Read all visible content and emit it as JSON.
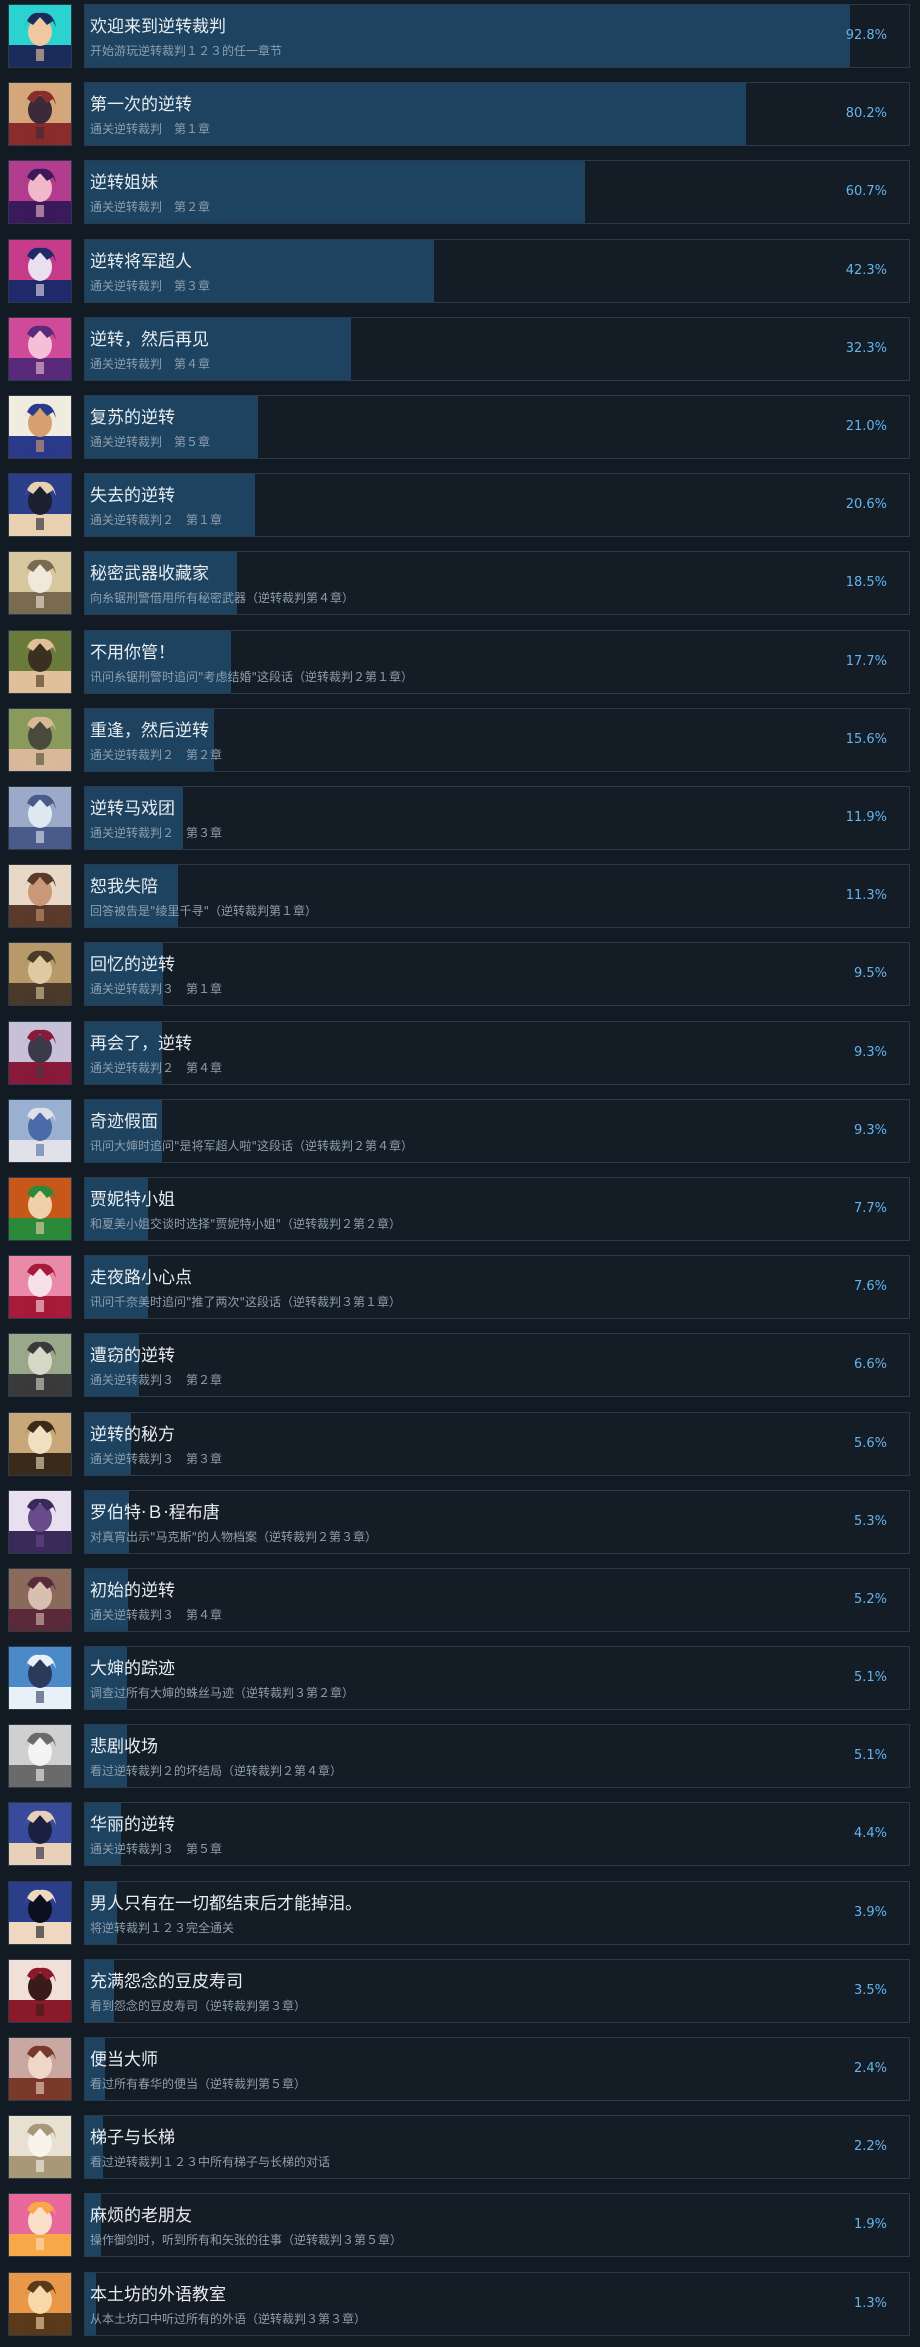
{
  "achievements": [
    {
      "title": "欢迎来到逆转裁判",
      "description": "开始游玩逆转裁判１２３的任一章节",
      "percent": 92.8,
      "percent_label": "92.8%",
      "portrait": "phoenix-wright-portrait",
      "colors": [
        "#2ad3cf",
        "#1c2c5a",
        "#f0c8a0"
      ]
    },
    {
      "title": "第一次的逆转",
      "description": "通关逆转裁判　第１章",
      "percent": 80.2,
      "percent_label": "80.2%",
      "portrait": "episode-1-portrait",
      "colors": [
        "#d4a77a",
        "#8a2c2c",
        "#3a2a3a"
      ]
    },
    {
      "title": "逆转姐妹",
      "description": "通关逆转裁判　第２章",
      "percent": 60.7,
      "percent_label": "60.7%",
      "portrait": "episode-2-portrait",
      "colors": [
        "#b23c8e",
        "#3a1a5a",
        "#f0b8c8"
      ]
    },
    {
      "title": "逆转将军超人",
      "description": "通关逆转裁判　第３章",
      "percent": 42.3,
      "percent_label": "42.3%",
      "portrait": "episode-3-portrait",
      "colors": [
        "#c63c8a",
        "#1e2a6a",
        "#e8e0f0"
      ]
    },
    {
      "title": "逆转，然后再见",
      "description": "通关逆转裁判　第４章",
      "percent": 32.3,
      "percent_label": "32.3%",
      "portrait": "episode-4-portrait",
      "colors": [
        "#d04a9a",
        "#5a2a7a",
        "#f4c0d8"
      ]
    },
    {
      "title": "复苏的逆转",
      "description": "通关逆转裁判　第５章",
      "percent": 21.0,
      "percent_label": "21.0%",
      "portrait": "episode-5-portrait",
      "colors": [
        "#f0ece0",
        "#2c3a8a",
        "#d8a070"
      ]
    },
    {
      "title": "失去的逆转",
      "description": "通关逆转裁判２　第１章",
      "percent": 20.6,
      "percent_label": "20.6%",
      "portrait": "lost-turnabout-portrait",
      "colors": [
        "#2a3e8a",
        "#e8d0b0",
        "#1a2030"
      ]
    },
    {
      "title": "秘密武器收藏家",
      "description": "向糸锯刑警借用所有秘密武器（逆转裁判第４章）",
      "percent": 18.5,
      "percent_label": "18.5%",
      "portrait": "gumshoe-portrait",
      "colors": [
        "#d8c8a0",
        "#7a6a50",
        "#f0e8d8"
      ]
    },
    {
      "title": "不用你管！",
      "description": "讯问糸锯刑警时追问\"考虑结婚\"这段话（逆转裁判２第１章）",
      "percent": 17.7,
      "percent_label": "17.7%",
      "portrait": "gumshoe-coat-portrait",
      "colors": [
        "#6a7a3a",
        "#e0c098",
        "#3a3020"
      ]
    },
    {
      "title": "重逢，然后逆转",
      "description": "通关逆转裁判２　第２章",
      "percent": 15.6,
      "percent_label": "15.6%",
      "portrait": "reunion-portrait",
      "colors": [
        "#8a9a5a",
        "#d8b898",
        "#4a4a3a"
      ]
    },
    {
      "title": "逆转马戏团",
      "description": "通关逆转裁判２　第３章",
      "percent": 11.9,
      "percent_label": "11.9%",
      "portrait": "circus-portrait",
      "colors": [
        "#9aaac8",
        "#4a5a8a",
        "#e0e8f0"
      ]
    },
    {
      "title": "恕我失陪",
      "description": "回答被告是\"绫里千寻\"（逆转裁判第１章）",
      "percent": 11.3,
      "percent_label": "11.3%",
      "portrait": "mia-fey-portrait",
      "colors": [
        "#e8d8c8",
        "#5a3a2a",
        "#c89878"
      ]
    },
    {
      "title": "回忆的逆转",
      "description": "通关逆转裁判３　第１章",
      "percent": 9.5,
      "percent_label": "9.5%",
      "portrait": "memories-portrait",
      "colors": [
        "#b89a6a",
        "#4a3a2a",
        "#e0c8a0"
      ]
    },
    {
      "title": "再会了，逆转",
      "description": "通关逆转裁判２　第４章",
      "percent": 9.3,
      "percent_label": "9.3%",
      "portrait": "farewell-portrait",
      "colors": [
        "#c8c0d8",
        "#8a1a3a",
        "#3a3a4a"
      ]
    },
    {
      "title": "奇迹假面",
      "description": "讯问大婶时追问\"是将军超人啦\"这段话（逆转裁判２第４章）",
      "percent": 9.3,
      "percent_label": "9.3%",
      "portrait": "wendy-oldbag-portrait",
      "colors": [
        "#9ab0d0",
        "#e0e0e8",
        "#4a6aa8"
      ]
    },
    {
      "title": "贾妮特小姐",
      "description": "和夏美小姐交谈时选择\"贾妮特小姐\"（逆转裁判２第２章）",
      "percent": 7.7,
      "percent_label": "7.7%",
      "portrait": "lotta-hart-portrait",
      "colors": [
        "#c8581a",
        "#2a8a3a",
        "#f0d0a8"
      ]
    },
    {
      "title": "走夜路小心点",
      "description": "讯问千奈美时追问\"推了两次\"这段话（逆转裁判３第１章）",
      "percent": 7.6,
      "percent_label": "7.6%",
      "portrait": "dahlia-portrait",
      "colors": [
        "#e88aa8",
        "#a81a3a",
        "#f8e0e8"
      ]
    },
    {
      "title": "遭窃的逆转",
      "description": "通关逆转裁判３　第２章",
      "percent": 6.6,
      "percent_label": "6.6%",
      "portrait": "stolen-turnabout-portrait",
      "colors": [
        "#9aa88a",
        "#3a3a3a",
        "#d8d8c8"
      ]
    },
    {
      "title": "逆转的秘方",
      "description": "通关逆转裁判３　第３章",
      "percent": 5.6,
      "percent_label": "5.6%",
      "portrait": "recipe-portrait",
      "colors": [
        "#c8a878",
        "#3a2a1a",
        "#f0e0c0"
      ]
    },
    {
      "title": "罗伯特·Ｂ·程布唐",
      "description": "对真宵出示\"马克斯\"的人物档案（逆转裁判２第３章）",
      "percent": 5.3,
      "percent_label": "5.3%",
      "portrait": "maya-fey-portrait",
      "colors": [
        "#e8e0f0",
        "#3a2a5a",
        "#6a4a8a"
      ]
    },
    {
      "title": "初始的逆转",
      "description": "通关逆转裁判３　第４章",
      "percent": 5.2,
      "percent_label": "5.2%",
      "portrait": "beginnings-portrait",
      "colors": [
        "#8a6a5a",
        "#5a2a3a",
        "#d8c0b0"
      ]
    },
    {
      "title": "大婶的踪迹",
      "description": "调查过所有大婶的蛛丝马迹（逆转裁判３第２章）",
      "percent": 5.1,
      "percent_label": "5.1%",
      "portrait": "camera-portrait",
      "colors": [
        "#4a8ac8",
        "#e8f0f8",
        "#2a3a5a"
      ]
    },
    {
      "title": "悲剧收场",
      "description": "看过逆转裁判２的坏结局（逆转裁判２第４章）",
      "percent": 5.1,
      "percent_label": "5.1%",
      "portrait": "tragedy-portrait",
      "colors": [
        "#d0d0d0",
        "#6a6a6a",
        "#f4f4f4"
      ]
    },
    {
      "title": "华丽的逆转",
      "description": "通关逆转裁判３　第５章",
      "percent": 4.4,
      "percent_label": "4.4%",
      "portrait": "bridge-portrait",
      "colors": [
        "#3a4a9a",
        "#e8d0b8",
        "#1a2040"
      ]
    },
    {
      "title": "男人只有在一切都结束后才能掉泪。",
      "description": "将逆转裁判１２３完全通关",
      "percent": 3.9,
      "percent_label": "3.9%",
      "portrait": "godot-portrait",
      "colors": [
        "#2a3e8a",
        "#f0d8c0",
        "#0a1020"
      ]
    },
    {
      "title": "充满怨念的豆皮寿司",
      "description": "看到怨念的豆皮寿司（逆转裁判第３章）",
      "percent": 3.5,
      "percent_label": "3.5%",
      "portrait": "grudge-portrait",
      "colors": [
        "#f0e0d8",
        "#8a1a2a",
        "#3a1a1a"
      ]
    },
    {
      "title": "便当大师",
      "description": "看过所有春华的便当（逆转裁判第５章）",
      "percent": 2.4,
      "percent_label": "2.4%",
      "portrait": "bento-portrait",
      "colors": [
        "#c8a8a0",
        "#7a3a2a",
        "#f0d8c8"
      ]
    },
    {
      "title": "梯子与长梯",
      "description": "看过逆转裁判１２３中所有梯子与长梯的对话",
      "percent": 2.2,
      "percent_label": "2.2%",
      "portrait": "ladder-portrait",
      "colors": [
        "#e8e0d0",
        "#a89878",
        "#f8f4ec"
      ]
    },
    {
      "title": "麻烦的老朋友",
      "description": "操作御剑时，听到所有和矢张的往事（逆转裁判３第５章）",
      "percent": 1.9,
      "percent_label": "1.9%",
      "portrait": "larry-butz-portrait",
      "colors": [
        "#e8689a",
        "#f8a848",
        "#fae0c8"
      ]
    },
    {
      "title": "本土坊的外语教室",
      "description": "从本土坊口中听过所有的外语（逆转裁判３第３章）",
      "percent": 1.3,
      "percent_label": "1.3%",
      "portrait": "glen-elg-portrait",
      "colors": [
        "#e89848",
        "#5a3a1a",
        "#f8d8a8"
      ]
    }
  ]
}
